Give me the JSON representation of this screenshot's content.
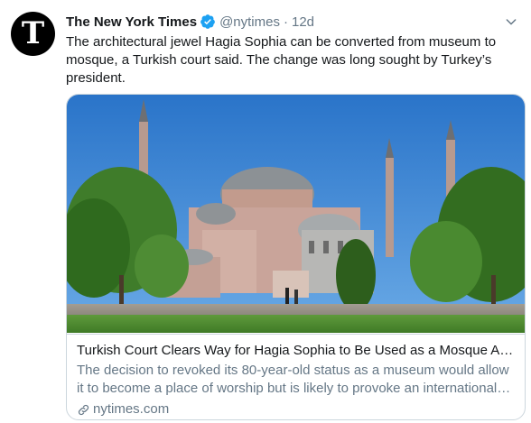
{
  "tweet": {
    "avatar_glyph": "T",
    "display_name": "The New York Times",
    "handle": "@nytimes",
    "separator": "·",
    "time": "12d",
    "verified_icon": "verified-badge-icon",
    "menu_icon": "chevron-down-icon",
    "text": "The architectural jewel Hagia Sophia can be converted from museum to mosque, a Turkish court said. The change was long sought by Turkey’s president."
  },
  "card": {
    "image_icon": "hagia-sophia-photo",
    "title": "Turkish Court Clears Way for Hagia Sophia to Be Used as a Mosque Again",
    "description": "The decision to revoked its 80-year-old status as a museum would allow it to become a place of worship but is likely to provoke an international backlash.",
    "link_icon": "link-icon",
    "domain": "nytimes.com"
  },
  "colors": {
    "verified": "#1da1f2",
    "secondary_text": "#657786",
    "primary_text": "#14171a",
    "border": "#ccd6dd",
    "sky": "#2f7fd1",
    "building": "#c9a49a"
  }
}
